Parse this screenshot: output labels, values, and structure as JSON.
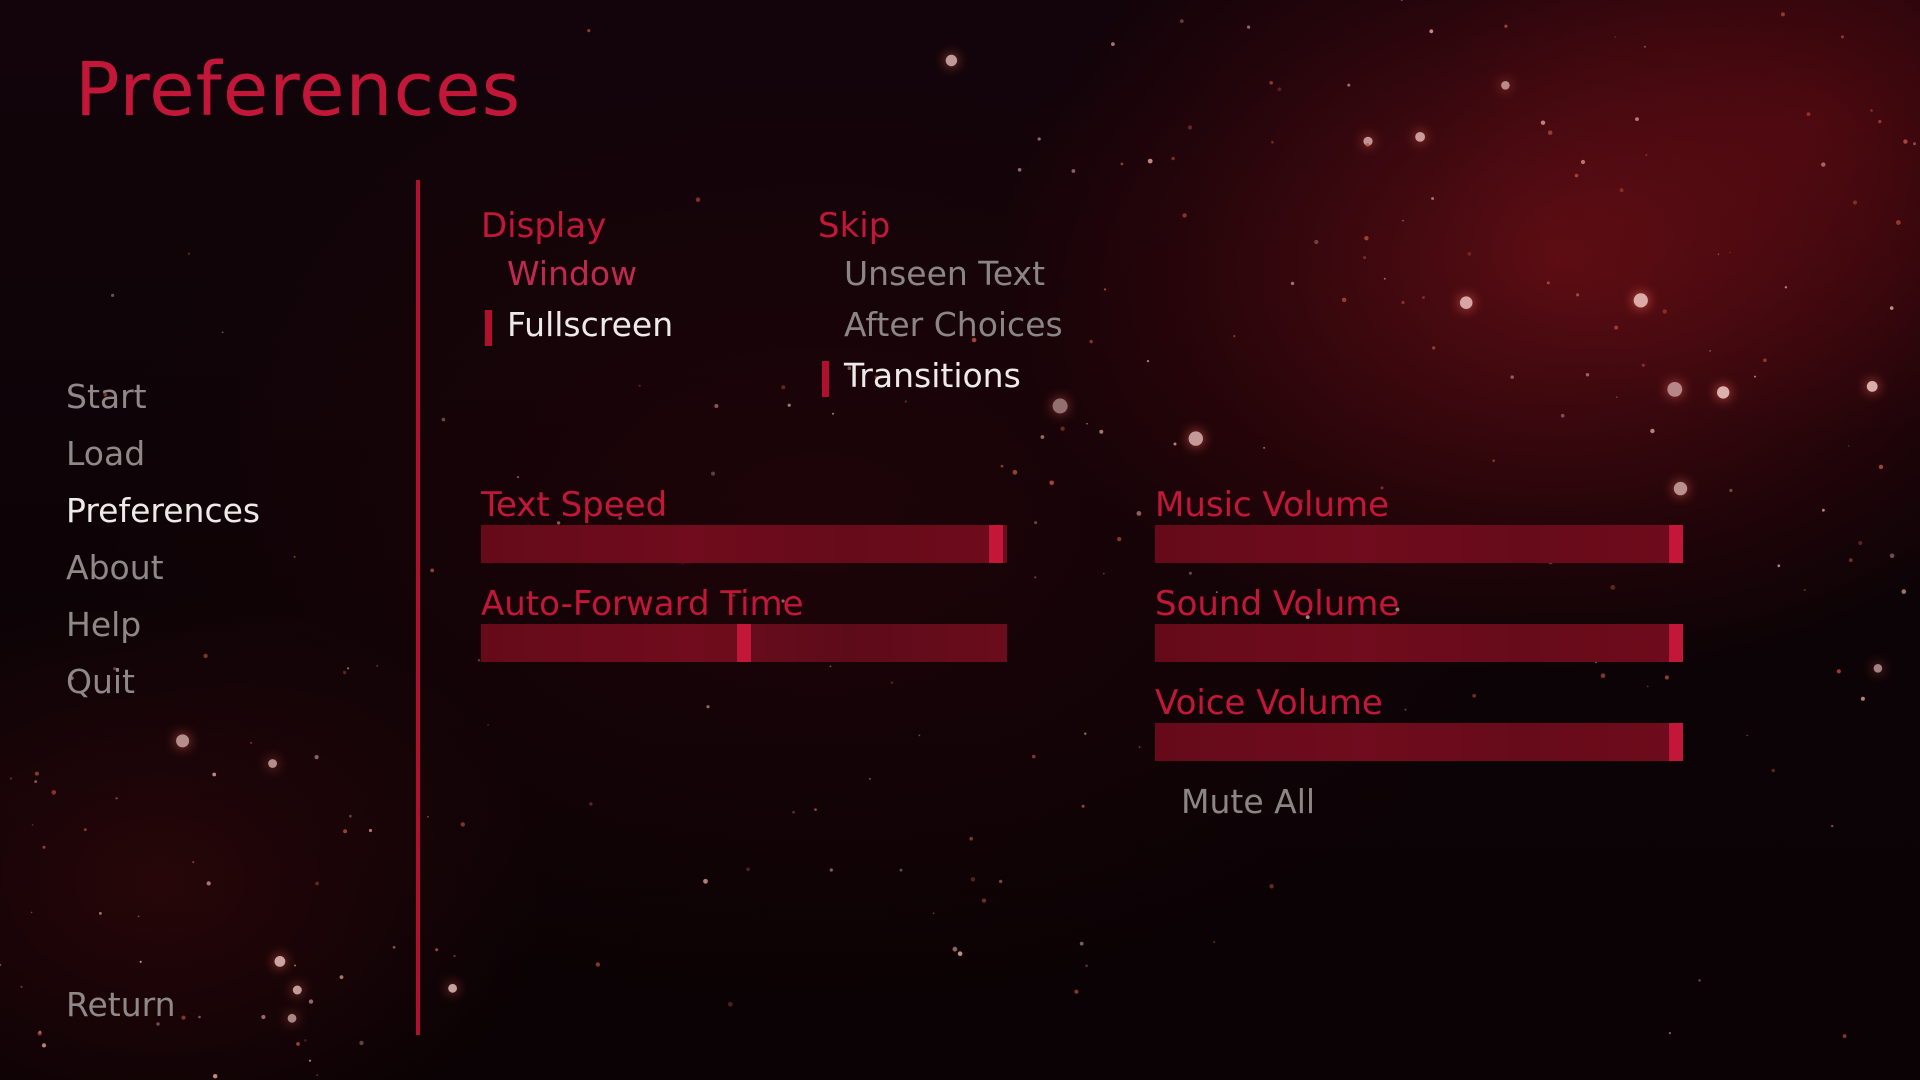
{
  "screen": {
    "title": "Preferences",
    "accent_color": "#c3173a"
  },
  "nav": {
    "items": [
      {
        "label": "Start",
        "active": false
      },
      {
        "label": "Load",
        "active": false
      },
      {
        "label": "Preferences",
        "active": true
      },
      {
        "label": "About",
        "active": false
      },
      {
        "label": "Help",
        "active": false
      },
      {
        "label": "Quit",
        "active": false
      }
    ],
    "return_label": "Return"
  },
  "display": {
    "label": "Display",
    "options": [
      {
        "label": "Window",
        "selected": false
      },
      {
        "label": "Fullscreen",
        "selected": true
      }
    ]
  },
  "skip": {
    "label": "Skip",
    "options": [
      {
        "label": "Unseen Text",
        "selected": false
      },
      {
        "label": "After Choices",
        "selected": false
      },
      {
        "label": "Transitions",
        "selected": true
      }
    ]
  },
  "sliders": {
    "text_speed": {
      "label": "Text Speed",
      "value": 0.98
    },
    "auto_forward": {
      "label": "Auto-Forward Time",
      "value": 0.5
    },
    "music_volume": {
      "label": "Music Volume",
      "value": 0.99
    },
    "sound_volume": {
      "label": "Sound Volume",
      "value": 0.99
    },
    "voice_volume": {
      "label": "Voice Volume",
      "value": 0.99
    }
  },
  "mute_all": {
    "label": "Mute All",
    "checked": false
  }
}
